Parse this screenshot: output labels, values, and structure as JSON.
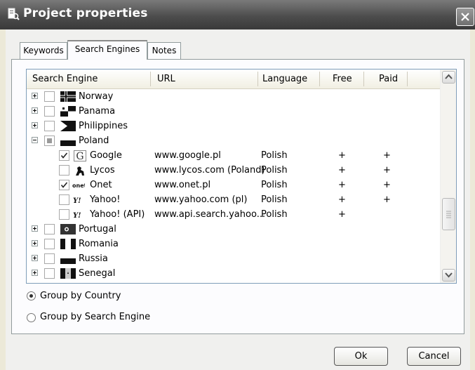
{
  "window": {
    "title": "Project properties",
    "icon": "project-properties-icon"
  },
  "tabs": [
    {
      "label": "Keywords",
      "active": false
    },
    {
      "label": "Search Engines",
      "active": true
    },
    {
      "label": "Notes",
      "active": false
    }
  ],
  "table": {
    "columns": [
      "Search Engine",
      "URL",
      "Language",
      "Free",
      "Paid"
    ],
    "rows": [
      {
        "type": "country",
        "label": "Norway",
        "expanded": false,
        "checked": "unchecked",
        "flag": "norway-flag"
      },
      {
        "type": "country",
        "label": "Panama",
        "expanded": false,
        "checked": "unchecked",
        "flag": "panama-flag"
      },
      {
        "type": "country",
        "label": "Philippines",
        "expanded": false,
        "checked": "unchecked",
        "flag": "philippines-flag"
      },
      {
        "type": "country",
        "label": "Poland",
        "expanded": true,
        "checked": "partial",
        "flag": "poland-flag"
      },
      {
        "type": "engine",
        "label": "Google",
        "checked": true,
        "icon": "google-icon",
        "url": "www.google.pl",
        "language": "Polish",
        "free": "+",
        "paid": "+"
      },
      {
        "type": "engine",
        "label": "Lycos",
        "checked": false,
        "icon": "lycos-icon",
        "url": "www.lycos.com (Poland)",
        "language": "Polish",
        "free": "+",
        "paid": "+"
      },
      {
        "type": "engine",
        "label": "Onet",
        "checked": true,
        "icon": "onet-icon",
        "url": "www.onet.pl",
        "language": "Polish",
        "free": "+",
        "paid": "+"
      },
      {
        "type": "engine",
        "label": "Yahoo!",
        "checked": false,
        "icon": "yahoo-icon",
        "url": "www.yahoo.com (pl)",
        "language": "Polish",
        "free": "+",
        "paid": "+"
      },
      {
        "type": "engine",
        "label": "Yahoo! (API)",
        "checked": false,
        "icon": "yahoo-icon",
        "url": "www.api.search.yahoo...",
        "language": "Polish",
        "free": "+",
        "paid": ""
      },
      {
        "type": "country",
        "label": "Portugal",
        "expanded": false,
        "checked": "unchecked",
        "flag": "portugal-flag"
      },
      {
        "type": "country",
        "label": "Romania",
        "expanded": false,
        "checked": "unchecked",
        "flag": "romania-flag"
      },
      {
        "type": "country",
        "label": "Russia",
        "expanded": false,
        "checked": "unchecked",
        "flag": "russia-flag"
      },
      {
        "type": "country",
        "label": "Senegal",
        "expanded": false,
        "checked": "unchecked",
        "flag": "senegal-flag"
      }
    ]
  },
  "grouping": {
    "by_country": {
      "label": "Group by Country",
      "selected": true
    },
    "by_engine": {
      "label": "Group by Search Engine",
      "selected": false
    }
  },
  "buttons": {
    "ok": "Ok",
    "cancel": "Cancel"
  }
}
